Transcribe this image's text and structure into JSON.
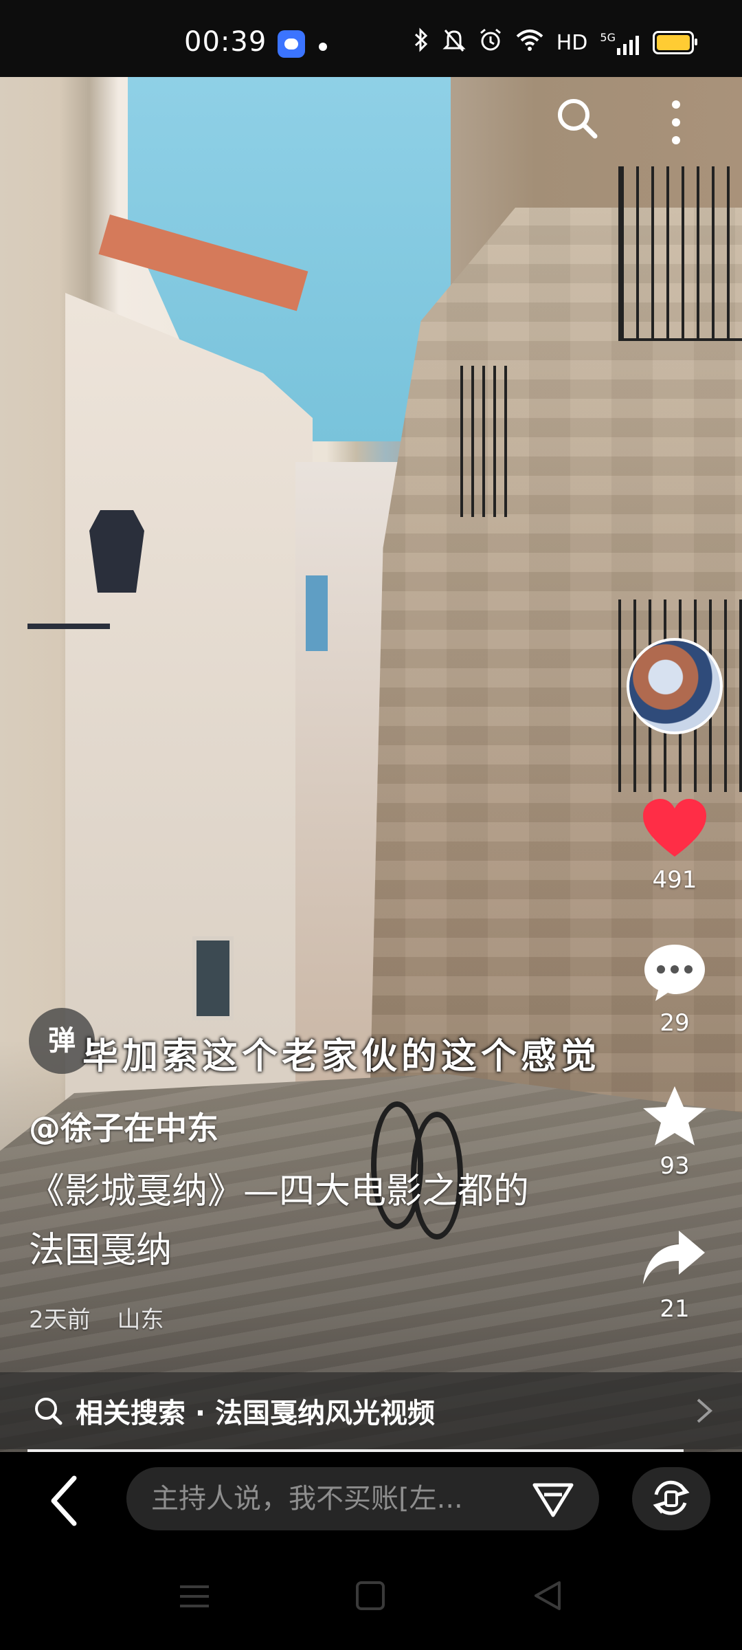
{
  "status_bar": {
    "time": "00:39",
    "icons": [
      "app-badge",
      "dot",
      "bluetooth-icon",
      "mute-icon",
      "alarm-icon",
      "wifi-icon",
      "HD",
      "5G",
      "signal-icon",
      "battery-icon"
    ],
    "hd": "HD",
    "network": "5G",
    "battery_color": "#ffcc33"
  },
  "video": {
    "caption": "毕加索这个老家伙的这个感觉",
    "danmu_label": "弹",
    "author": "@徐子在中东",
    "description": "《影城戛纳》—四大电影之都的法国戛纳",
    "time_ago": "2天前",
    "location": "山东"
  },
  "rail": {
    "likes": "491",
    "comments": "29",
    "favorites": "93",
    "shares": "21",
    "like_color": "#ff2d46"
  },
  "related": {
    "text": "相关搜索 · 法国戛纳风光视频"
  },
  "bottom": {
    "comment_placeholder": "主持人说，我不买账[左..."
  }
}
